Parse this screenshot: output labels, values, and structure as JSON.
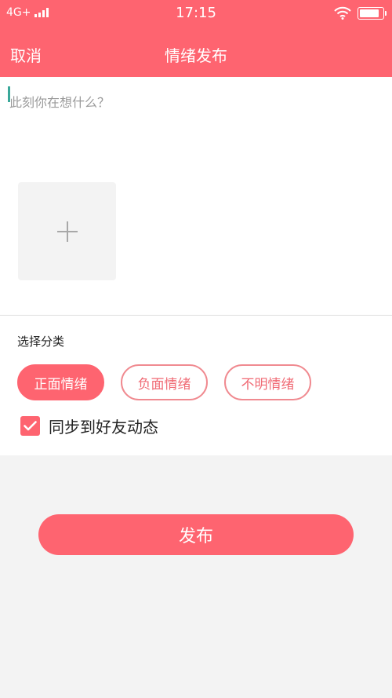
{
  "status_bar": {
    "network": "4G+",
    "time": "17:15",
    "signal_icon": "signal-bars-icon",
    "wifi_icon": "wifi-icon",
    "battery_icon": "battery-icon",
    "battery_level": 0.85
  },
  "nav": {
    "cancel_label": "取消",
    "title": "情绪发布"
  },
  "editor": {
    "placeholder": "此刻你在想什么？",
    "value": "",
    "add_photo_icon": "plus-icon"
  },
  "category": {
    "section_label": "选择分类",
    "options": [
      {
        "label": "正面情绪",
        "selected": true
      },
      {
        "label": "负面情绪",
        "selected": false
      },
      {
        "label": "不明情绪",
        "selected": false
      }
    ]
  },
  "sync": {
    "label": "同步到好友动态",
    "checked": true,
    "check_icon": "checkmark-icon"
  },
  "publish": {
    "label": "发布"
  },
  "colors": {
    "accent": "#fe6470",
    "chip_border": "#f08a90",
    "background": "#f3f3f3",
    "caret": "#3aa89a"
  }
}
